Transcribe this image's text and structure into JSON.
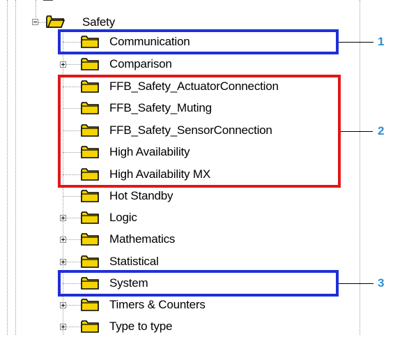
{
  "tree": {
    "root": {
      "label": "Safety",
      "icon": "open-folder-icon",
      "expanded": true
    },
    "items": [
      {
        "label": "Communication",
        "expander": "none"
      },
      {
        "label": "Comparison",
        "expander": "plus"
      },
      {
        "label": "FFB_Safety_ActuatorConnection",
        "expander": "none"
      },
      {
        "label": "FFB_Safety_Muting",
        "expander": "none"
      },
      {
        "label": "FFB_Safety_SensorConnection",
        "expander": "none"
      },
      {
        "label": "High Availability",
        "expander": "none"
      },
      {
        "label": "High Availability MX",
        "expander": "none"
      },
      {
        "label": "Hot Standby",
        "expander": "none"
      },
      {
        "label": "Logic",
        "expander": "plus"
      },
      {
        "label": "Mathematics",
        "expander": "plus"
      },
      {
        "label": "Statistical",
        "expander": "plus"
      },
      {
        "label": "System",
        "expander": "none"
      },
      {
        "label": "Timers & Counters",
        "expander": "plus"
      },
      {
        "label": "Type to type",
        "expander": "plus"
      }
    ]
  },
  "callouts": [
    {
      "number": "1",
      "color": "#1f2fd6"
    },
    {
      "number": "2",
      "color": "#e01818"
    },
    {
      "number": "3",
      "color": "#1f2fd6"
    }
  ],
  "colors": {
    "folder_fill": "#f5d400",
    "folder_stroke": "#000000",
    "callout_number": "#2a8fd6"
  }
}
